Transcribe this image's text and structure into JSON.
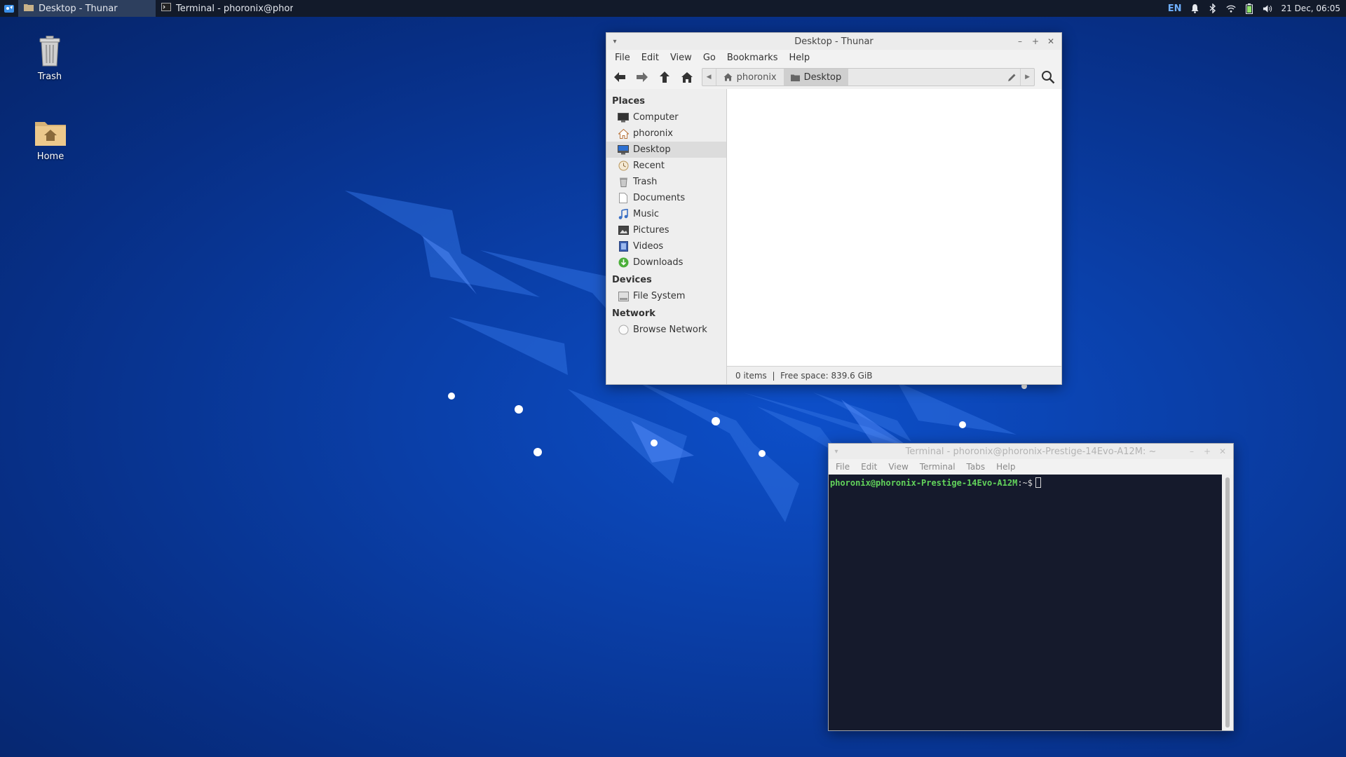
{
  "panel": {
    "tasks": [
      {
        "label": "Desktop - Thunar",
        "icon": "folder-icon",
        "active": true
      },
      {
        "label": "Terminal - phoronix@phoro...",
        "icon": "terminal-icon",
        "active": false
      }
    ],
    "tray": {
      "language": "EN",
      "icons": [
        "bell-icon",
        "bluetooth-icon",
        "wifi-icon",
        "battery-icon",
        "volume-icon"
      ],
      "clock": "21 Dec, 06:05"
    }
  },
  "desktop": {
    "icons": [
      {
        "label": "Trash",
        "icon": "trash-icon"
      },
      {
        "label": "Home",
        "icon": "home-folder-icon"
      }
    ]
  },
  "thunar": {
    "title": "Desktop - Thunar",
    "menu": [
      "File",
      "Edit",
      "View",
      "Go",
      "Bookmarks",
      "Help"
    ],
    "path": {
      "crumbs": [
        "phoronix",
        "Desktop"
      ],
      "current": "Desktop"
    },
    "sidebar": {
      "places_header": "Places",
      "places": [
        {
          "label": "Computer",
          "icon": "computer-icon"
        },
        {
          "label": "phoronix",
          "icon": "home-icon"
        },
        {
          "label": "Desktop",
          "icon": "desktop-icon",
          "selected": true
        },
        {
          "label": "Recent",
          "icon": "recent-icon"
        },
        {
          "label": "Trash",
          "icon": "trash-icon"
        },
        {
          "label": "Documents",
          "icon": "documents-icon"
        },
        {
          "label": "Music",
          "icon": "music-icon"
        },
        {
          "label": "Pictures",
          "icon": "pictures-icon"
        },
        {
          "label": "Videos",
          "icon": "videos-icon"
        },
        {
          "label": "Downloads",
          "icon": "downloads-icon"
        }
      ],
      "devices_header": "Devices",
      "devices": [
        {
          "label": "File System",
          "icon": "drive-icon"
        }
      ],
      "network_header": "Network",
      "network": [
        {
          "label": "Browse Network",
          "icon": "network-icon"
        }
      ]
    },
    "status": "0 items  |  Free space: 839.6 GiB"
  },
  "terminal": {
    "title": "Terminal - phoronix@phoronix-Prestige-14Evo-A12M: ~",
    "menu": [
      "File",
      "Edit",
      "View",
      "Terminal",
      "Tabs",
      "Help"
    ],
    "prompt_user_host": "phoronix@phoronix-Prestige-14Evo-A12M",
    "prompt_suffix": ":~$"
  },
  "colors": {
    "desktop_blue": "#0a3fa8",
    "panel": "#121a2a",
    "terminal_bg": "#151a2c",
    "prompt_green": "#62d35b",
    "accent": "#6fb0ff"
  }
}
